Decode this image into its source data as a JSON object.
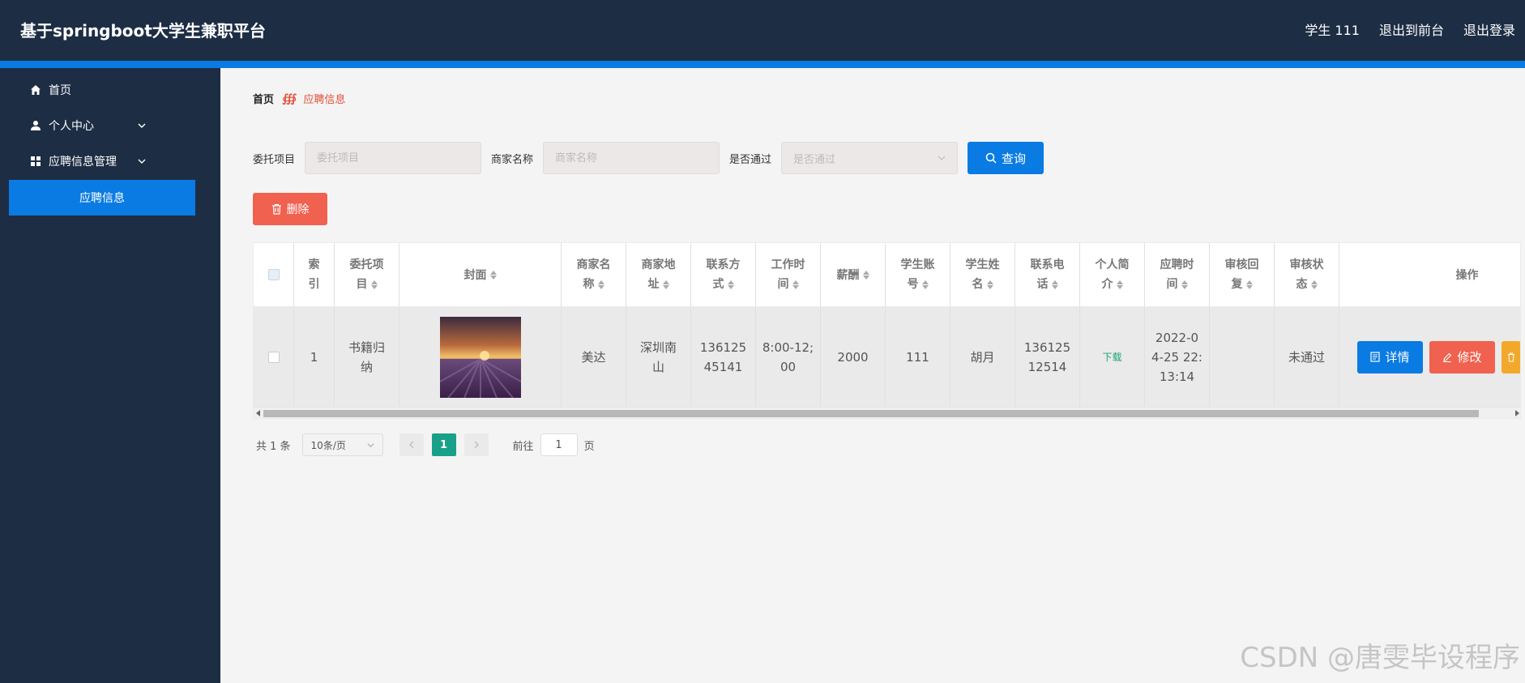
{
  "header": {
    "title": "基于springboot大学生兼职平台",
    "user": "学生 111",
    "back_front": "退出到前台",
    "logout": "退出登录"
  },
  "sidebar": {
    "items": [
      {
        "label": "首页",
        "icon": "home-icon"
      },
      {
        "label": "个人中心",
        "icon": "user-icon"
      },
      {
        "label": "应聘信息管理",
        "icon": "grid-icon"
      }
    ],
    "active": "应聘信息"
  },
  "breadcrumb": {
    "home": "首页",
    "separator": "∰",
    "current": "应聘信息"
  },
  "search": {
    "project_label": "委托项目",
    "project_placeholder": "委托项目",
    "merchant_label": "商家名称",
    "merchant_placeholder": "商家名称",
    "pass_label": "是否通过",
    "pass_placeholder": "是否通过",
    "query_button": "查询"
  },
  "toolbar": {
    "delete_label": "删除"
  },
  "table": {
    "headers": [
      [
        "索",
        "引"
      ],
      [
        "委托项",
        "目"
      ],
      [
        "封面",
        ""
      ],
      [
        "商家名",
        "称"
      ],
      [
        "商家地",
        "址"
      ],
      [
        "联系方",
        "式"
      ],
      [
        "工作时",
        "间"
      ],
      [
        "薪酬",
        ""
      ],
      [
        "学生账",
        "号"
      ],
      [
        "学生姓",
        "名"
      ],
      [
        "联系电",
        "话"
      ],
      [
        "个人简",
        "介"
      ],
      [
        "应聘时",
        "间"
      ],
      [
        "审核回",
        "复"
      ],
      [
        "审核状",
        "态"
      ],
      [
        "操作",
        ""
      ]
    ],
    "rows": [
      {
        "index": "1",
        "project": [
          "书籍归",
          "纳"
        ],
        "merchant_name": "美达",
        "merchant_addr": [
          "深圳南",
          "山"
        ],
        "contact": [
          "136125",
          "45141"
        ],
        "work_time": [
          "8:00-12;",
          "00"
        ],
        "salary": "2000",
        "student_account": "111",
        "student_name": "胡月",
        "phone": [
          "136125",
          "12514"
        ],
        "intro": "下载",
        "apply_time": [
          "2022-0",
          "4-25 22:",
          "13:14"
        ],
        "review_reply": "",
        "review_status": "未通过",
        "ops": {
          "detail": "详情",
          "edit": "修改"
        }
      }
    ]
  },
  "pagination": {
    "total": "共 1 条",
    "page_size": "10条/页",
    "current_page": "1",
    "goto_label": "前往",
    "goto_value": "1",
    "page_suffix": "页"
  },
  "watermark": "CSDN @唐雯毕设程序",
  "colors": {
    "primary": "#0a7be2",
    "danger": "#f0614f",
    "warning": "#f2a92b",
    "success": "#19a089",
    "nav": "#1d2d44"
  }
}
